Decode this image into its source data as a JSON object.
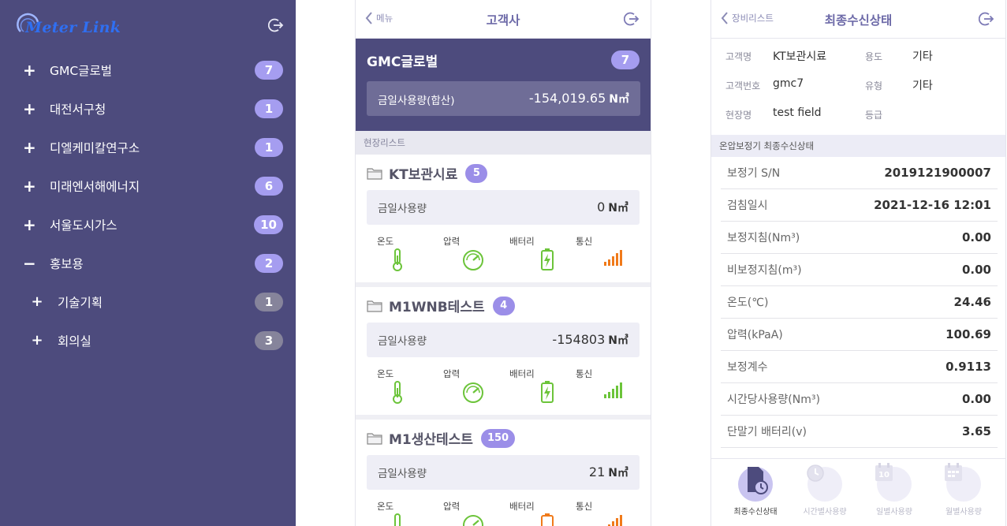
{
  "sidebar": {
    "logo_text": "Meter Link",
    "items": [
      {
        "sign": "+",
        "label": "GMC글로벌",
        "count": "7"
      },
      {
        "sign": "+",
        "label": "대전서구청",
        "count": "1"
      },
      {
        "sign": "+",
        "label": "디엘케미칼연구소",
        "count": "1"
      },
      {
        "sign": "+",
        "label": "미래엔서해에너지",
        "count": "6"
      },
      {
        "sign": "+",
        "label": "서울도시가스",
        "count": "10"
      },
      {
        "sign": "−",
        "label": "홍보용",
        "count": "2"
      }
    ],
    "sub_items": [
      {
        "sign": "+",
        "label": "기술기획",
        "count": "1"
      },
      {
        "sign": "+",
        "label": "회의실",
        "count": "3"
      }
    ]
  },
  "customer_panel": {
    "back_label": "메뉴",
    "title": "고객사",
    "customer_name": "GMC글로벌",
    "customer_count": "7",
    "total_label": "금일사용량(합산)",
    "total_value": "-154,019.65",
    "unit": "N㎥",
    "section_label": "현장리스트",
    "sensor_labels": {
      "temp": "온도",
      "pressure": "압력",
      "battery": "배터리",
      "signal": "통신"
    },
    "sites": [
      {
        "name": "KT보관시료",
        "count": "5",
        "usage_label": "금일사용량",
        "usage_value": "0",
        "unit": "N㎥",
        "battery_status": "ok",
        "signal_color": "#f07a1a"
      },
      {
        "name": "M1WNB테스트",
        "count": "4",
        "usage_label": "금일사용량",
        "usage_value": "-154803",
        "unit": "N㎥",
        "battery_status": "ok",
        "signal_color": "#6cc43a"
      },
      {
        "name": "M1생산테스트",
        "count": "150",
        "usage_label": "금일사용량",
        "usage_value": "21",
        "unit": "N㎥",
        "battery_status": "low",
        "signal_color": "#f07a1a"
      }
    ]
  },
  "status_panel": {
    "back_label": "장비리스트",
    "title": "최종수신상태",
    "info": {
      "customer_name_label": "고객명",
      "customer_name": "KT보관시료",
      "usage_type_label": "용도",
      "usage_type": "기타",
      "customer_no_label": "고객번호",
      "customer_no": "gmc7",
      "kind_label": "유형",
      "kind": "기타",
      "site_label": "현장명",
      "site": "test field",
      "grade_label": "등급",
      "grade": ""
    },
    "section_label": "온압보정기 최종수신상태",
    "rows": [
      {
        "label": "보정기 S/N",
        "value": "2019121900007"
      },
      {
        "label": "검침일시",
        "value": "2021-12-16 12:01"
      },
      {
        "label": "보정지침(Nm³)",
        "value": "0.00"
      },
      {
        "label": "비보정지침(m³)",
        "value": "0.00"
      },
      {
        "label": "온도(℃)",
        "value": "24.46"
      },
      {
        "label": "압력(kPaA)",
        "value": "100.69"
      },
      {
        "label": "보정계수",
        "value": "0.9113"
      },
      {
        "label": "시간당사용량(Nm³)",
        "value": "0.00"
      },
      {
        "label": "단말기 배터리(v)",
        "value": "3.65"
      }
    ],
    "tabs": [
      {
        "label": "최종수신상태",
        "active": true
      },
      {
        "label": "시간별사용량",
        "active": false
      },
      {
        "label": "일별사용량",
        "active": false,
        "icon_text": "10"
      },
      {
        "label": "월별사용량",
        "active": false
      }
    ]
  },
  "colors": {
    "sidebar_bg": "#4d4b7d",
    "badge": "#a59df0",
    "badge_grey": "#86849b",
    "accent": "#6d6aa8",
    "sensor_green": "#6cc43a",
    "sensor_orange": "#f07a1a"
  }
}
